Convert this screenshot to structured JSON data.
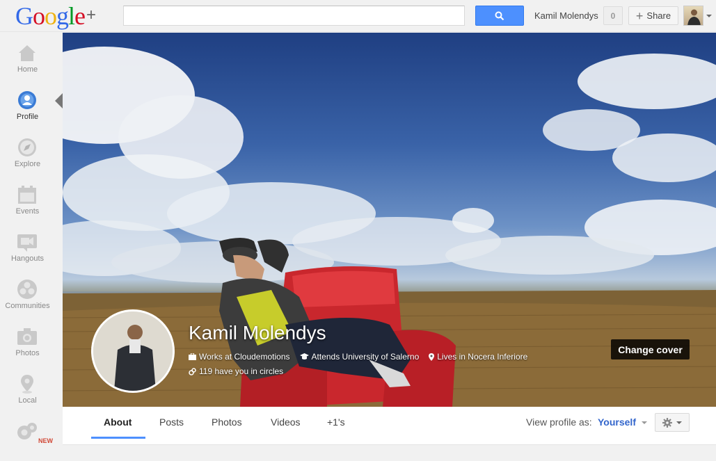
{
  "header": {
    "logo_word": "Google",
    "logo_plus": "+",
    "search_value": "",
    "user_name": "Kamil Molendys",
    "notification_count": "0",
    "share_label": "Share"
  },
  "sidebar": {
    "items": [
      {
        "label": "Home",
        "icon": "home-icon"
      },
      {
        "label": "Profile",
        "icon": "profile-icon"
      },
      {
        "label": "Explore",
        "icon": "compass-icon"
      },
      {
        "label": "Events",
        "icon": "calendar-icon"
      },
      {
        "label": "Hangouts",
        "icon": "video-camera-icon"
      },
      {
        "label": "Communities",
        "icon": "communities-icon"
      },
      {
        "label": "Photos",
        "icon": "camera-icon"
      },
      {
        "label": "Local",
        "icon": "map-pin-icon"
      },
      {
        "label": "",
        "icon": "games-icon"
      }
    ],
    "new_badge": "NEW",
    "active_index": 1
  },
  "profile": {
    "name": "Kamil Molendys",
    "works": "Works at Cloudemotions",
    "attends": "Attends University of Salerno",
    "lives": "Lives in Nocera Inferiore",
    "circles": "119 have you in circles",
    "change_cover_label": "Change cover"
  },
  "tabs": [
    {
      "label": "About"
    },
    {
      "label": "Posts"
    },
    {
      "label": "Photos"
    },
    {
      "label": "Videos"
    },
    {
      "label": "+1's"
    }
  ],
  "view_profile": {
    "label": "View profile as:",
    "value": "Yourself"
  },
  "colors": {
    "accent": "#4d90fe",
    "link": "#3366cc",
    "new_badge": "#d14836"
  }
}
